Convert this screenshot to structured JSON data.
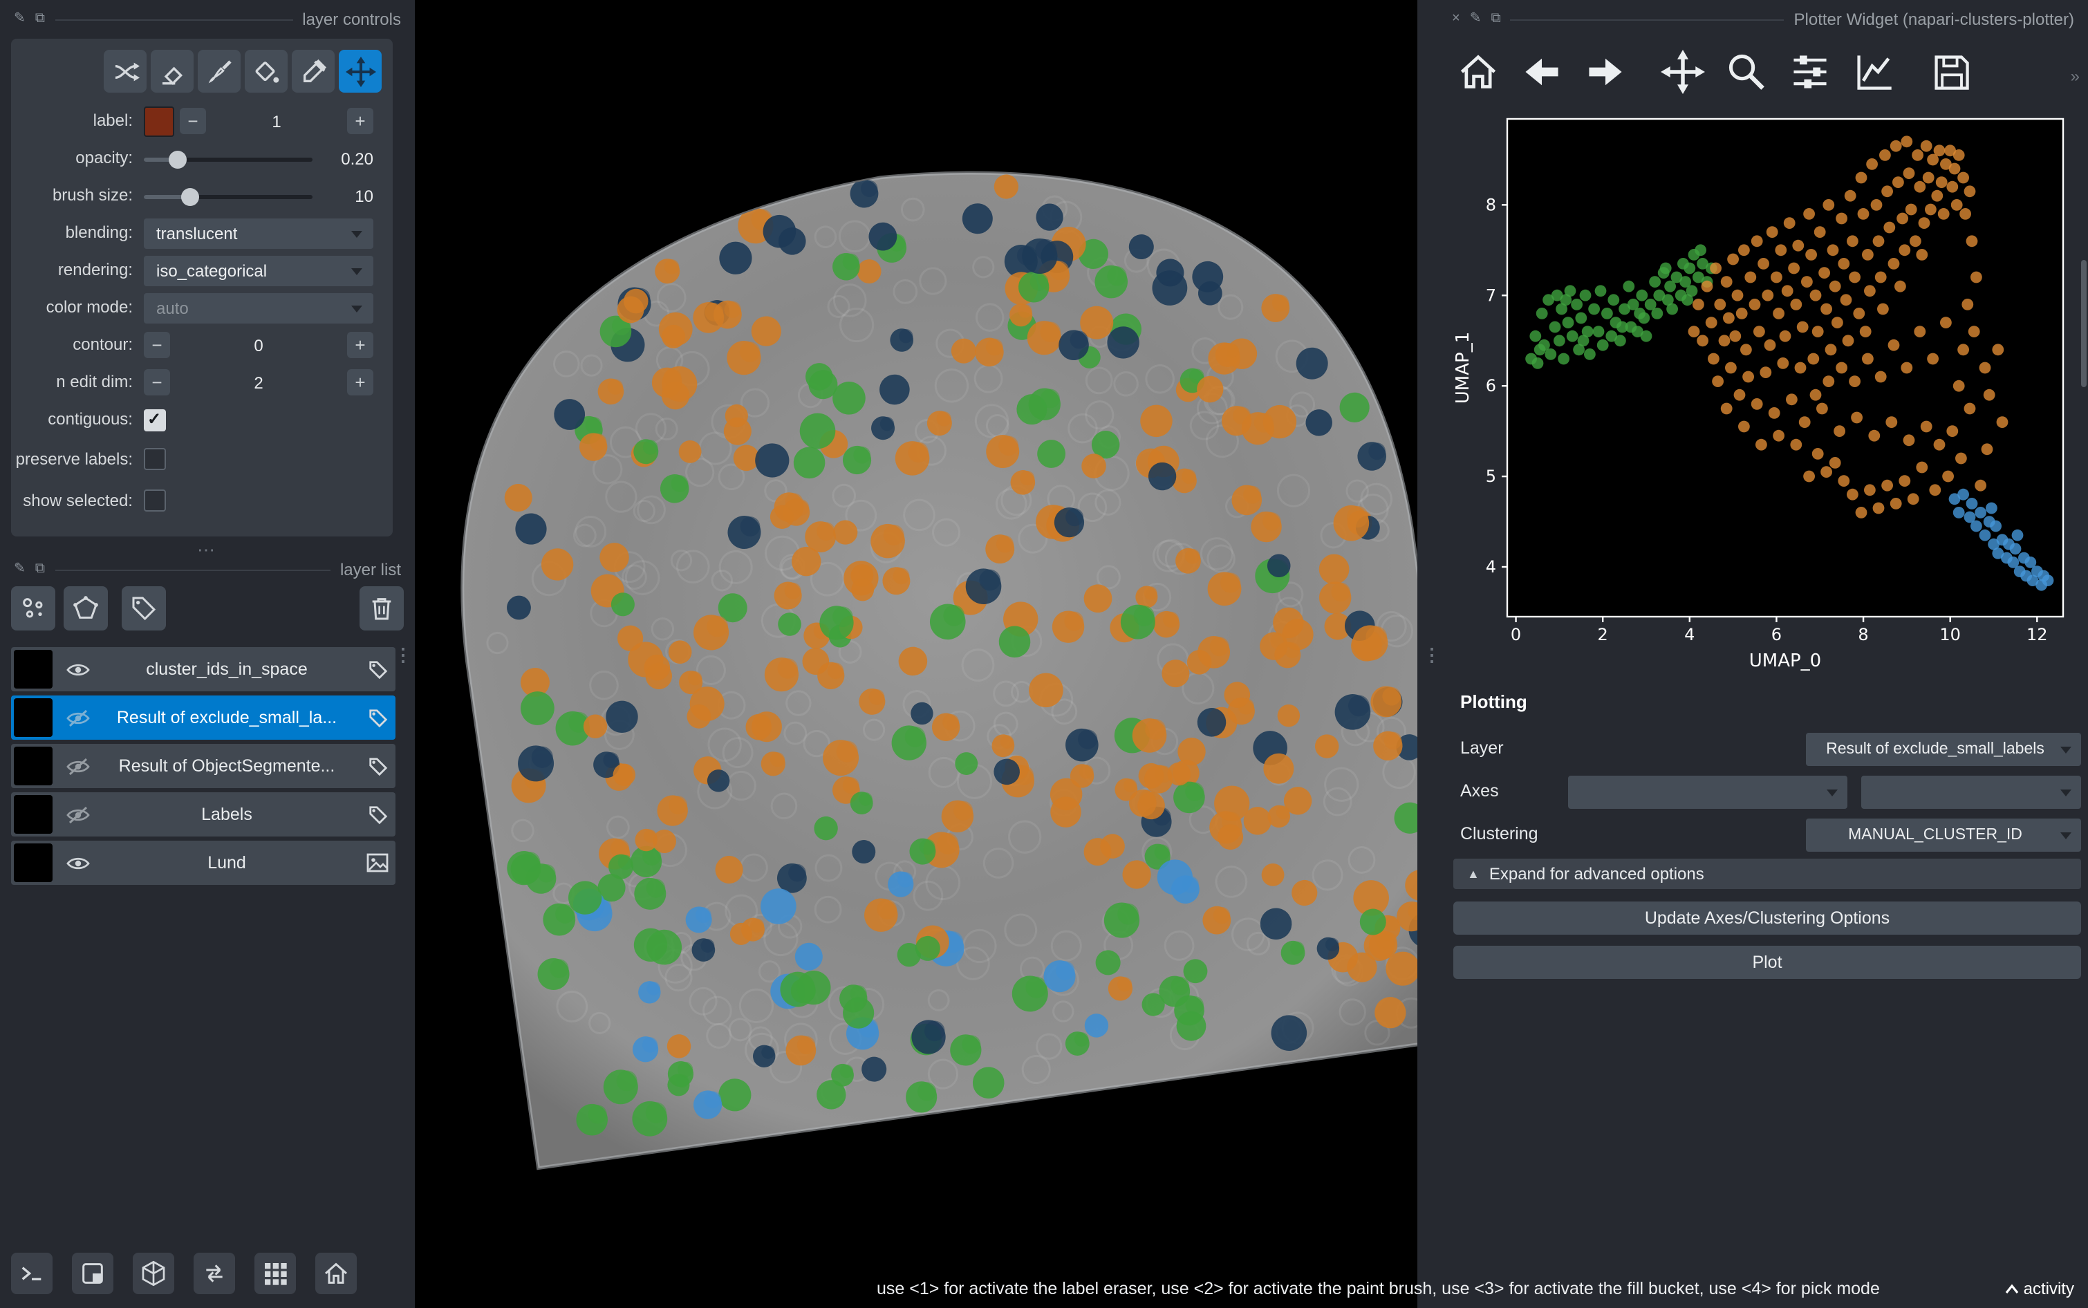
{
  "window": {
    "status_hint": "use <1> for activate the label eraser, use <2> for activate the paint brush, use <3> for activate the fill bucket, use <4> for pick mode",
    "activity_label": "activity"
  },
  "layer_controls": {
    "title": "layer controls",
    "active_tool": "pan-zoom",
    "minus": "−",
    "plus": "+",
    "label_row": {
      "label": "label:",
      "value": "1",
      "swatch_color": "#7c2b14"
    },
    "opacity": {
      "label": "opacity:",
      "value": "0.20",
      "percent": 20
    },
    "brush_size": {
      "label": "brush size:",
      "value": "10",
      "percent": 27
    },
    "blending": {
      "label": "blending:",
      "value": "translucent"
    },
    "rendering": {
      "label": "rendering:",
      "value": "iso_categorical"
    },
    "color_mode": {
      "label": "color mode:",
      "value": "auto"
    },
    "contour": {
      "label": "contour:",
      "value": "0"
    },
    "n_edit_dim": {
      "label": "n edit dim:",
      "value": "2"
    },
    "contiguous": {
      "label": "contiguous:",
      "checked": true
    },
    "preserve_labels": {
      "label": "preserve labels:",
      "checked": false
    },
    "show_selected": {
      "label": "show selected:",
      "checked": false
    }
  },
  "layer_list": {
    "title": "layer list",
    "layers": [
      {
        "name": "cluster_ids_in_space",
        "visible": true,
        "selected": false,
        "type": "labels",
        "thumb": "speckle-bright"
      },
      {
        "name": "Result of exclude_small_la...",
        "visible": false,
        "selected": true,
        "type": "labels",
        "thumb": "speckle-dim"
      },
      {
        "name": "Result of ObjectSegmente...",
        "visible": false,
        "selected": false,
        "type": "labels",
        "thumb": "speckle-color"
      },
      {
        "name": "Labels",
        "visible": false,
        "selected": false,
        "type": "labels",
        "thumb": "black"
      },
      {
        "name": "Lund",
        "visible": true,
        "selected": false,
        "type": "image",
        "thumb": "lund"
      }
    ]
  },
  "viewer": {
    "cluster_colors": {
      "orange": "#d07c26",
      "green": "#3fa23c",
      "navy": "#1d3a57",
      "blue": "#3f8ed2"
    },
    "tissue_base_color": "#8a8a8a"
  },
  "plotter": {
    "title": "Plotter Widget (napari-clusters-plotter)",
    "section_title": "Plotting",
    "layer_label": "Layer",
    "layer_value": "Result of exclude_small_labels",
    "axes_label": "Axes",
    "clustering_label": "Clustering",
    "clustering_value": "MANUAL_CLUSTER_ID",
    "advanced_label": "Expand for advanced options",
    "update_button_label": "Update Axes/Clustering Options",
    "plot_button_label": "Plot"
  },
  "chart_data": {
    "type": "scatter",
    "xlabel": "UMAP_0",
    "ylabel": "UMAP_1",
    "xlim": [
      -0.2,
      12.6
    ],
    "ylim": [
      3.45,
      8.95
    ],
    "xticks": [
      0,
      2,
      4,
      6,
      8,
      10,
      12
    ],
    "yticks": [
      4,
      5,
      6,
      7,
      8
    ],
    "background": "#000000",
    "grid": false,
    "legend": false,
    "point_radius": 4.2,
    "series": [
      {
        "name": "cluster-green",
        "color": "#3fa33f",
        "points": [
          [
            0.35,
            6.3
          ],
          [
            0.45,
            6.55
          ],
          [
            0.5,
            6.25
          ],
          [
            0.6,
            6.8
          ],
          [
            0.65,
            6.45
          ],
          [
            0.75,
            6.95
          ],
          [
            0.8,
            6.35
          ],
          [
            0.9,
            6.65
          ],
          [
            0.95,
            7.0
          ],
          [
            1.0,
            6.5
          ],
          [
            1.05,
            6.85
          ],
          [
            1.1,
            6.3
          ],
          [
            1.2,
            6.7
          ],
          [
            1.25,
            7.05
          ],
          [
            1.3,
            6.55
          ],
          [
            1.4,
            6.9
          ],
          [
            1.45,
            6.4
          ],
          [
            1.5,
            6.75
          ],
          [
            1.6,
            7.0
          ],
          [
            1.65,
            6.6
          ],
          [
            1.7,
            6.35
          ],
          [
            1.8,
            6.85
          ],
          [
            1.9,
            6.6
          ],
          [
            1.95,
            7.05
          ],
          [
            2.0,
            6.45
          ],
          [
            2.1,
            6.8
          ],
          [
            2.2,
            6.55
          ],
          [
            2.25,
            6.95
          ],
          [
            2.3,
            6.7
          ],
          [
            2.4,
            6.5
          ],
          [
            2.5,
            6.85
          ],
          [
            2.6,
            7.1
          ],
          [
            2.65,
            6.65
          ],
          [
            2.7,
            6.9
          ],
          [
            2.8,
            6.6
          ],
          [
            2.9,
            7.0
          ],
          [
            2.95,
            6.75
          ],
          [
            3.0,
            6.55
          ],
          [
            3.1,
            6.9
          ],
          [
            3.2,
            7.15
          ],
          [
            3.25,
            6.8
          ],
          [
            3.3,
            7.0
          ],
          [
            3.4,
            7.25
          ],
          [
            3.5,
            6.95
          ],
          [
            3.55,
            7.1
          ],
          [
            3.6,
            6.85
          ],
          [
            3.7,
            7.2
          ],
          [
            3.8,
            7.0
          ],
          [
            3.85,
            7.35
          ],
          [
            3.9,
            7.15
          ],
          [
            4.0,
            7.3
          ],
          [
            4.05,
            7.05
          ],
          [
            4.1,
            7.45
          ],
          [
            4.2,
            7.2
          ],
          [
            4.3,
            7.35
          ],
          [
            4.4,
            7.15
          ],
          [
            4.5,
            7.3
          ],
          [
            1.15,
            6.95
          ],
          [
            2.45,
            6.65
          ],
          [
            3.45,
            7.3
          ],
          [
            0.55,
            6.4
          ],
          [
            1.55,
            6.5
          ],
          [
            2.85,
            6.8
          ],
          [
            3.95,
            6.95
          ],
          [
            4.25,
            7.5
          ]
        ]
      },
      {
        "name": "cluster-orange",
        "color": "#dd8a33",
        "points": [
          [
            4.1,
            6.6
          ],
          [
            4.2,
            6.9
          ],
          [
            4.3,
            6.5
          ],
          [
            4.4,
            7.1
          ],
          [
            4.5,
            6.7
          ],
          [
            4.55,
            6.3
          ],
          [
            4.6,
            7.3
          ],
          [
            4.7,
            6.9
          ],
          [
            4.8,
            6.5
          ],
          [
            4.85,
            7.15
          ],
          [
            4.9,
            6.75
          ],
          [
            5.0,
            7.4
          ],
          [
            5.05,
            6.55
          ],
          [
            5.1,
            7.0
          ],
          [
            5.2,
            6.8
          ],
          [
            5.25,
            7.5
          ],
          [
            5.3,
            6.4
          ],
          [
            5.4,
            7.2
          ],
          [
            5.5,
            6.9
          ],
          [
            5.55,
            7.6
          ],
          [
            5.6,
            6.6
          ],
          [
            5.7,
            7.35
          ],
          [
            5.8,
            7.0
          ],
          [
            5.85,
            6.45
          ],
          [
            5.9,
            7.7
          ],
          [
            6.0,
            7.2
          ],
          [
            6.05,
            6.8
          ],
          [
            6.1,
            7.5
          ],
          [
            6.2,
            6.55
          ],
          [
            6.25,
            7.05
          ],
          [
            6.3,
            7.8
          ],
          [
            6.4,
            7.3
          ],
          [
            6.45,
            6.9
          ],
          [
            6.5,
            7.55
          ],
          [
            6.6,
            6.65
          ],
          [
            6.7,
            7.15
          ],
          [
            6.75,
            7.9
          ],
          [
            6.8,
            7.45
          ],
          [
            6.9,
            7.0
          ],
          [
            6.95,
            6.6
          ],
          [
            7.0,
            7.7
          ],
          [
            7.1,
            7.25
          ],
          [
            7.15,
            6.85
          ],
          [
            7.2,
            8.0
          ],
          [
            7.3,
            7.5
          ],
          [
            7.35,
            7.1
          ],
          [
            7.4,
            6.7
          ],
          [
            7.5,
            7.85
          ],
          [
            7.55,
            7.35
          ],
          [
            7.6,
            6.95
          ],
          [
            7.7,
            8.1
          ],
          [
            7.75,
            7.6
          ],
          [
            7.8,
            7.2
          ],
          [
            7.9,
            6.8
          ],
          [
            7.95,
            8.3
          ],
          [
            8.0,
            7.9
          ],
          [
            8.1,
            7.45
          ],
          [
            8.15,
            7.05
          ],
          [
            8.2,
            8.45
          ],
          [
            8.3,
            8.0
          ],
          [
            8.35,
            7.6
          ],
          [
            8.4,
            7.2
          ],
          [
            8.5,
            8.55
          ],
          [
            8.55,
            8.15
          ],
          [
            8.6,
            7.75
          ],
          [
            8.7,
            7.35
          ],
          [
            8.75,
            8.65
          ],
          [
            8.8,
            8.25
          ],
          [
            8.9,
            7.85
          ],
          [
            8.95,
            7.5
          ],
          [
            9.0,
            8.7
          ],
          [
            9.05,
            8.35
          ],
          [
            9.1,
            7.95
          ],
          [
            9.2,
            7.6
          ],
          [
            9.25,
            8.55
          ],
          [
            9.3,
            8.2
          ],
          [
            9.4,
            7.8
          ],
          [
            9.45,
            8.65
          ],
          [
            9.5,
            8.3
          ],
          [
            9.55,
            7.95
          ],
          [
            9.6,
            8.5
          ],
          [
            9.7,
            8.1
          ],
          [
            9.75,
            8.6
          ],
          [
            9.8,
            8.25
          ],
          [
            9.9,
            8.45
          ],
          [
            10.0,
            8.6
          ],
          [
            10.05,
            8.2
          ],
          [
            10.1,
            8.4
          ],
          [
            10.2,
            8.55
          ],
          [
            10.3,
            8.3
          ],
          [
            10.15,
            8.0
          ],
          [
            9.85,
            7.9
          ],
          [
            9.35,
            7.45
          ],
          [
            8.85,
            7.1
          ],
          [
            8.45,
            6.85
          ],
          [
            8.05,
            6.6
          ],
          [
            7.65,
            6.5
          ],
          [
            7.25,
            6.4
          ],
          [
            6.85,
            6.3
          ],
          [
            6.55,
            6.2
          ],
          [
            6.15,
            6.25
          ],
          [
            5.75,
            6.15
          ],
          [
            5.35,
            6.1
          ],
          [
            4.95,
            6.2
          ],
          [
            4.65,
            6.05
          ],
          [
            5.15,
            5.9
          ],
          [
            5.55,
            5.8
          ],
          [
            5.95,
            5.7
          ],
          [
            6.35,
            5.85
          ],
          [
            6.65,
            5.6
          ],
          [
            7.05,
            5.75
          ],
          [
            7.45,
            5.5
          ],
          [
            7.85,
            5.65
          ],
          [
            8.25,
            5.45
          ],
          [
            8.65,
            5.6
          ],
          [
            9.05,
            5.4
          ],
          [
            9.45,
            5.55
          ],
          [
            9.75,
            5.35
          ],
          [
            10.05,
            5.5
          ],
          [
            10.25,
            5.2
          ],
          [
            9.95,
            5.0
          ],
          [
            9.65,
            4.85
          ],
          [
            9.35,
            5.1
          ],
          [
            9.15,
            4.75
          ],
          [
            8.95,
            4.95
          ],
          [
            8.75,
            4.7
          ],
          [
            8.55,
            4.9
          ],
          [
            8.35,
            4.65
          ],
          [
            8.15,
            4.85
          ],
          [
            7.95,
            4.6
          ],
          [
            7.75,
            4.8
          ],
          [
            7.55,
            4.95
          ],
          [
            7.35,
            5.15
          ],
          [
            7.15,
            5.05
          ],
          [
            6.95,
            5.25
          ],
          [
            6.75,
            5.0
          ],
          [
            6.45,
            5.35
          ],
          [
            6.05,
            5.45
          ],
          [
            5.65,
            5.35
          ],
          [
            5.25,
            5.55
          ],
          [
            4.85,
            5.75
          ],
          [
            10.35,
            7.9
          ],
          [
            10.45,
            8.15
          ],
          [
            10.5,
            7.6
          ],
          [
            10.4,
            6.9
          ],
          [
            10.3,
            6.4
          ],
          [
            10.2,
            6.0
          ],
          [
            10.45,
            5.75
          ],
          [
            10.55,
            6.6
          ],
          [
            10.6,
            7.2
          ],
          [
            9.9,
            6.7
          ],
          [
            9.6,
            6.3
          ],
          [
            9.3,
            6.6
          ],
          [
            9.0,
            6.2
          ],
          [
            8.7,
            6.45
          ],
          [
            8.4,
            6.1
          ],
          [
            8.1,
            6.3
          ],
          [
            7.8,
            6.05
          ],
          [
            7.5,
            6.2
          ],
          [
            7.2,
            6.05
          ],
          [
            6.9,
            5.9
          ],
          [
            10.8,
            6.2
          ],
          [
            10.9,
            5.9
          ],
          [
            11.1,
            6.4
          ],
          [
            11.2,
            5.6
          ],
          [
            10.7,
            4.9
          ],
          [
            10.85,
            5.3
          ]
        ]
      },
      {
        "name": "cluster-blue",
        "color": "#4596d8",
        "points": [
          [
            10.1,
            4.75
          ],
          [
            10.2,
            4.6
          ],
          [
            10.3,
            4.8
          ],
          [
            10.45,
            4.55
          ],
          [
            10.5,
            4.7
          ],
          [
            10.6,
            4.45
          ],
          [
            10.7,
            4.6
          ],
          [
            10.8,
            4.35
          ],
          [
            10.9,
            4.5
          ],
          [
            11.0,
            4.25
          ],
          [
            11.05,
            4.45
          ],
          [
            11.1,
            4.15
          ],
          [
            11.2,
            4.3
          ],
          [
            11.3,
            4.1
          ],
          [
            11.35,
            4.25
          ],
          [
            11.45,
            4.05
          ],
          [
            11.5,
            4.2
          ],
          [
            11.6,
            3.95
          ],
          [
            11.7,
            4.1
          ],
          [
            11.75,
            3.9
          ],
          [
            11.85,
            4.05
          ],
          [
            11.9,
            3.85
          ],
          [
            12.0,
            3.95
          ],
          [
            12.1,
            3.8
          ],
          [
            12.15,
            3.9
          ],
          [
            12.25,
            3.85
          ],
          [
            11.55,
            4.35
          ],
          [
            10.95,
            4.65
          ]
        ]
      }
    ]
  }
}
